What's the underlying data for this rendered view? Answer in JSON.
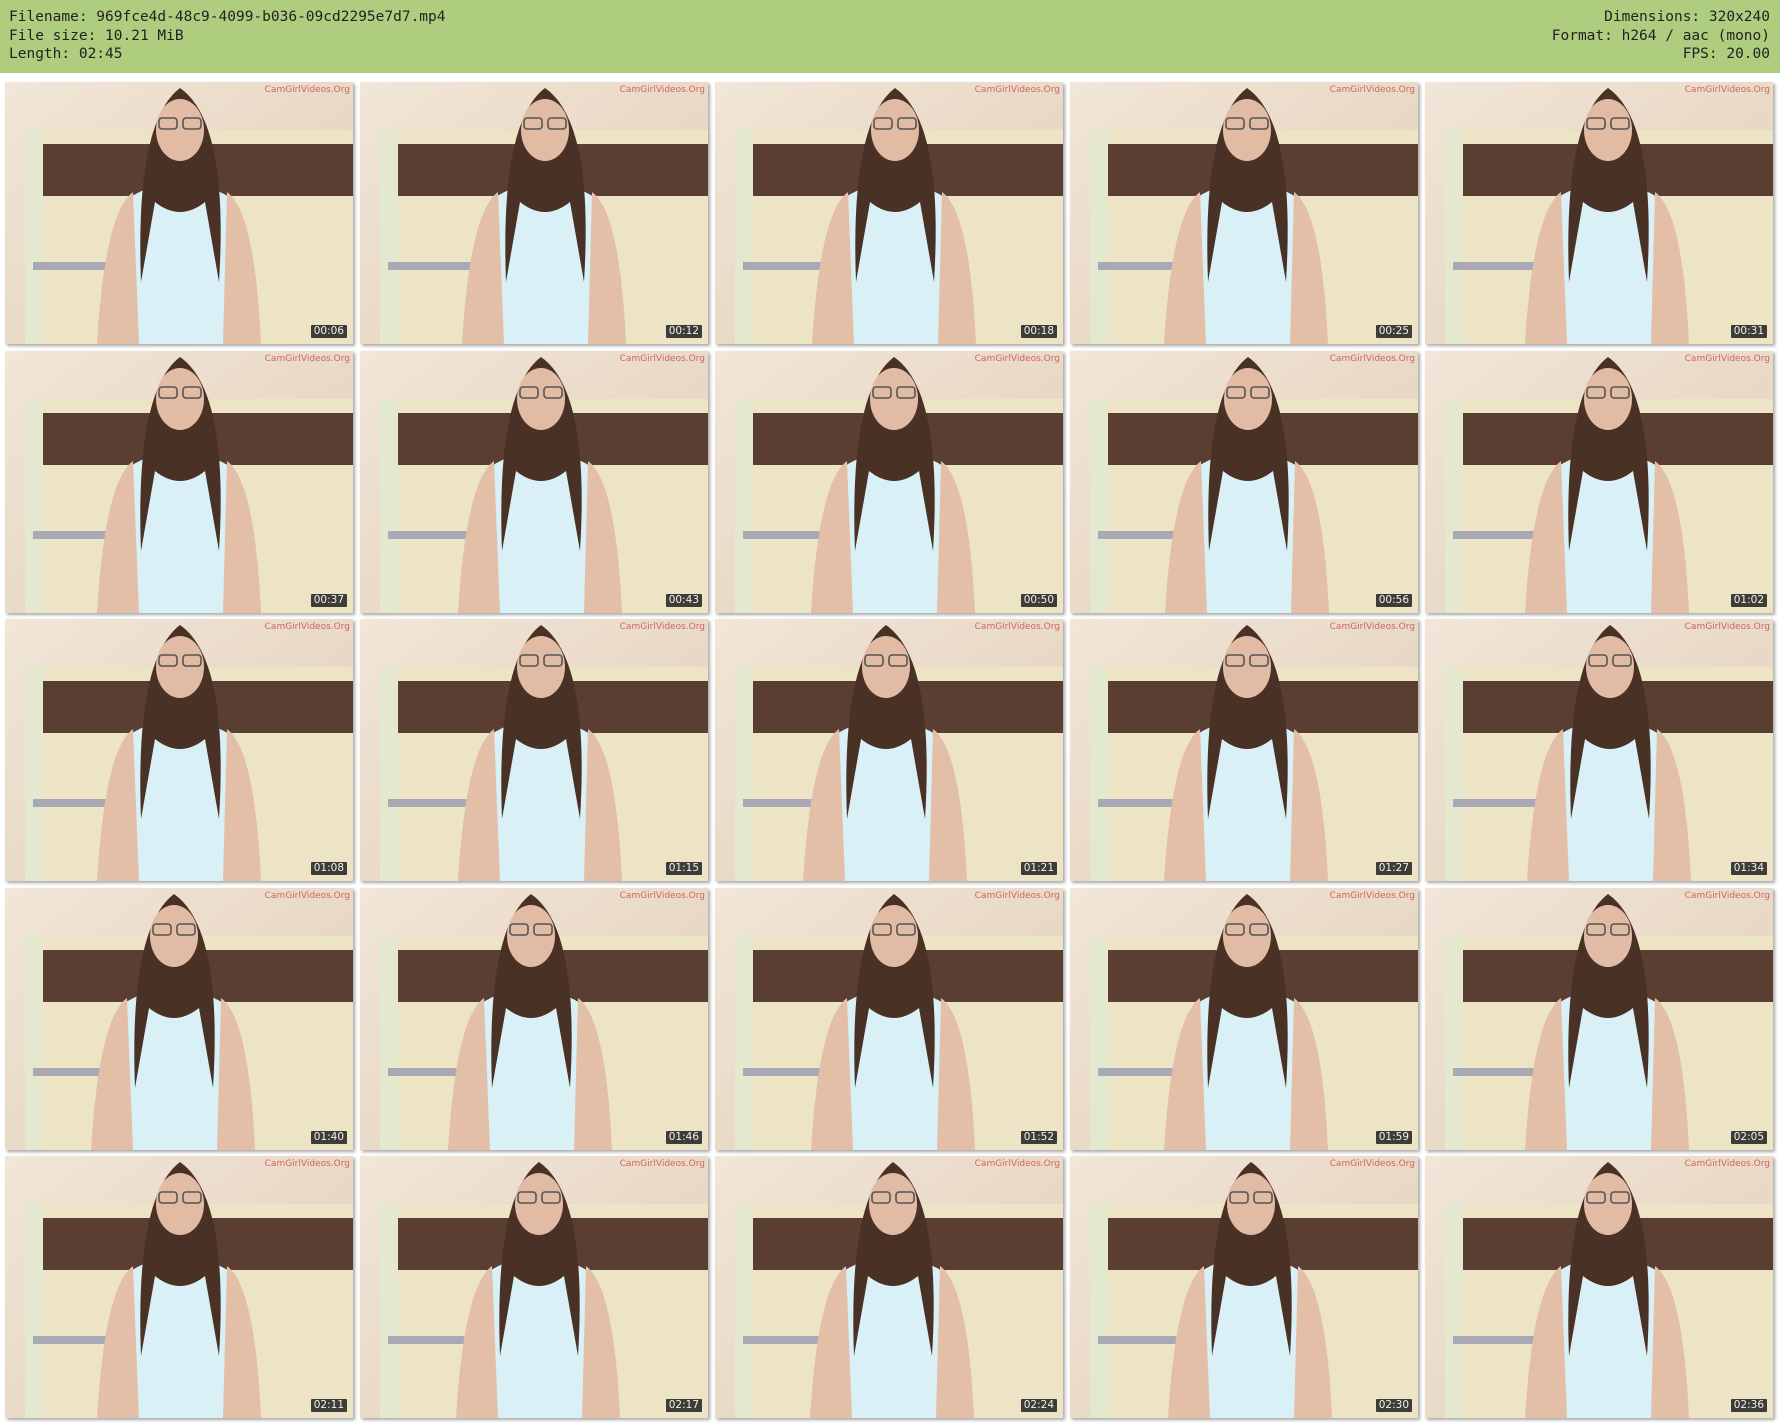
{
  "meta": {
    "filename": "Filename: 969fce4d-48c9-4099-b036-09cd2295e7d7.mp4",
    "file_size": "File size: 10.21 MiB",
    "length": "Length: 02:45",
    "dimensions": "Dimensions: 320x240",
    "format": "Format: h264 / aac (mono)",
    "fps": "FPS: 20.00"
  },
  "colors": {
    "header_bg": "#afcd7f",
    "timestamp_bg": "#1e1e1e",
    "watermark": "#c83c3c"
  },
  "watermark": "CamGirlVideos.Org",
  "thumbnails": [
    {
      "time": "00:06"
    },
    {
      "time": "00:12"
    },
    {
      "time": "00:18"
    },
    {
      "time": "00:25"
    },
    {
      "time": "00:31"
    },
    {
      "time": "00:37"
    },
    {
      "time": "00:43"
    },
    {
      "time": "00:50"
    },
    {
      "time": "00:56"
    },
    {
      "time": "01:02"
    },
    {
      "time": "01:08"
    },
    {
      "time": "01:15"
    },
    {
      "time": "01:21"
    },
    {
      "time": "01:27"
    },
    {
      "time": "01:34"
    },
    {
      "time": "01:40"
    },
    {
      "time": "01:46"
    },
    {
      "time": "01:52"
    },
    {
      "time": "01:59"
    },
    {
      "time": "02:05"
    },
    {
      "time": "02:11"
    },
    {
      "time": "02:17"
    },
    {
      "time": "02:24"
    },
    {
      "time": "02:30"
    },
    {
      "time": "02:36"
    }
  ]
}
